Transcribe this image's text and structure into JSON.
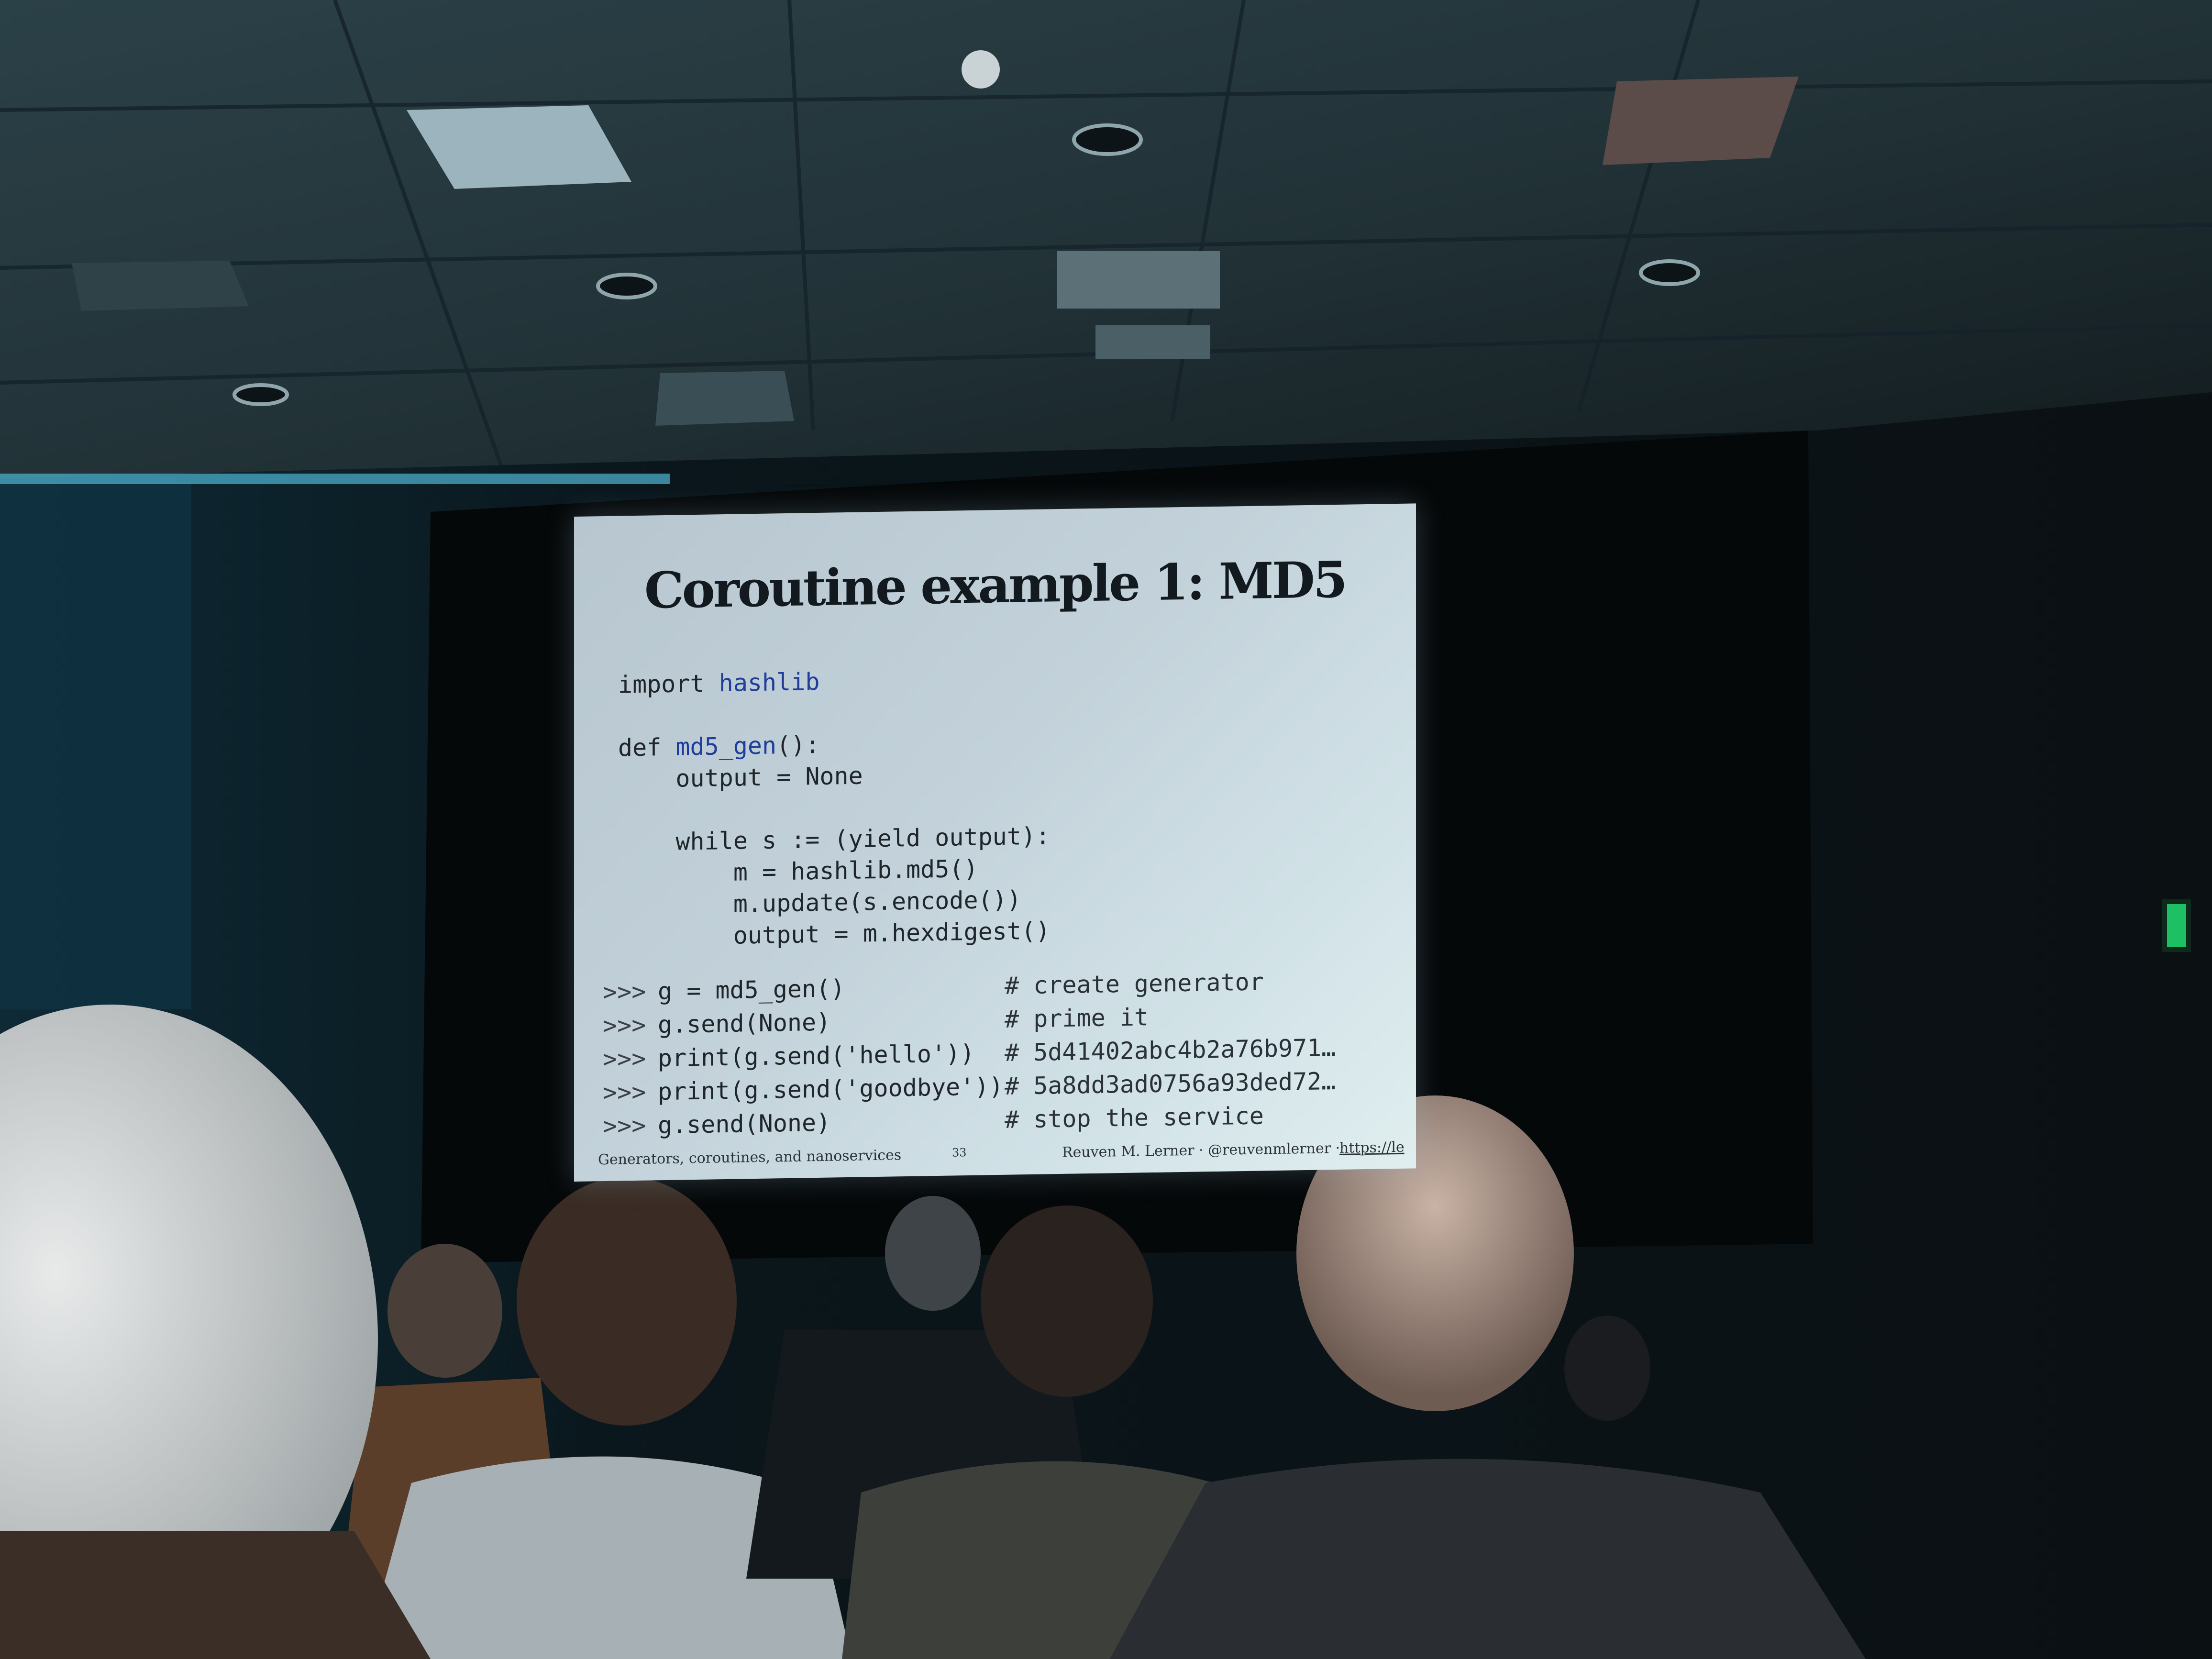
{
  "slide": {
    "title": "Coroutine example 1: MD5",
    "code_lines": [
      [
        {
          "t": "import ",
          "c": "kw"
        },
        {
          "t": "hashlib",
          "c": "nm"
        }
      ],
      [],
      [
        {
          "t": "def ",
          "c": "kw"
        },
        {
          "t": "md5_gen",
          "c": "nm"
        },
        {
          "t": "():",
          "c": "kw"
        }
      ],
      [
        {
          "t": "    output = None",
          "c": "kw"
        }
      ],
      [],
      [
        {
          "t": "    while s := (yield output):",
          "c": "kw"
        }
      ],
      [
        {
          "t": "        m = hashlib.md5()",
          "c": "kw"
        }
      ],
      [
        {
          "t": "        m.update(s.encode())",
          "c": "kw"
        }
      ],
      [
        {
          "t": "        output = m.hexdigest()",
          "c": "kw"
        }
      ]
    ],
    "repl": [
      {
        "prompt": ">>>",
        "cmd": "g = md5_gen()",
        "comment": "# create generator"
      },
      {
        "prompt": ">>>",
        "cmd": "g.send(None)",
        "comment": "# prime it"
      },
      {
        "prompt": ">>>",
        "cmd": "print(g.send('hello'))",
        "comment": "# 5d41402abc4b2a76b971…"
      },
      {
        "prompt": ">>>",
        "cmd": "print(g.send('goodbye'))",
        "comment": "# 5a8dd3ad0756a93ded72…"
      },
      {
        "prompt": ">>>",
        "cmd": "g.send(None)",
        "comment": "# stop the service"
      }
    ],
    "footer": {
      "deck": "Generators, coroutines, and nanoservices",
      "page": "33",
      "author": "Reuven M. Lerner · @reuvenmlerner ·",
      "url": "https://le"
    }
  },
  "colors": {
    "room": "#0b1114",
    "ceiling": "#1f3036",
    "slide_bg": "#c3d2da",
    "code_name": "#1f3e9a",
    "exit_sign": "#1fd06a"
  }
}
